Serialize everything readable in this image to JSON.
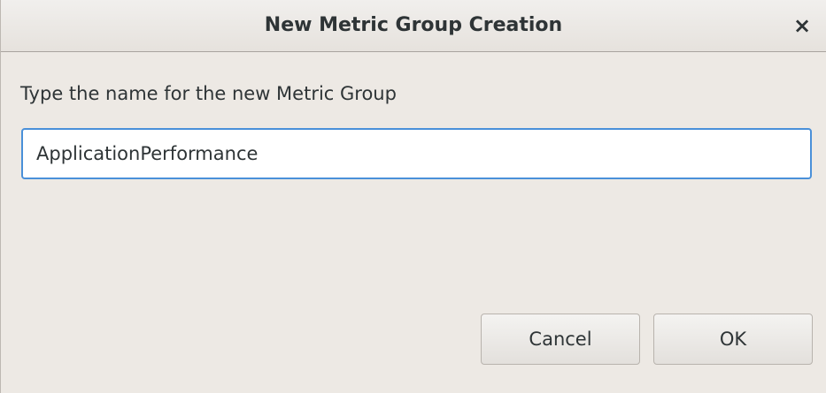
{
  "dialog": {
    "title": "New Metric Group Creation",
    "close_glyph": "×",
    "prompt": "Type the name for the new Metric Group",
    "name_value": "ApplicationPerformance",
    "cancel_label": "Cancel",
    "ok_label": "OK"
  },
  "icons": {
    "close": "close-icon"
  },
  "colors": {
    "accent": "#4a90d9",
    "background": "#ede9e4"
  }
}
